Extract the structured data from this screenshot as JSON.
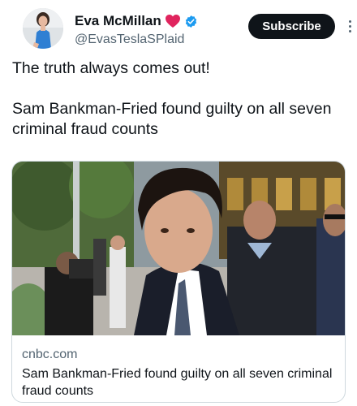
{
  "author": {
    "display_name": "Eva McMillan",
    "handle": "@EvasTeslaSPlaid",
    "avatar_icon": "profile-photo",
    "badge_icons": [
      "red-heart-icon",
      "verified-badge-icon"
    ]
  },
  "actions": {
    "subscribe_label": "Subscribe",
    "more_icon": "vertical-ellipsis-icon"
  },
  "tweet": {
    "line1": "The truth always comes out!",
    "line2": "Sam Bankman-Fried found guilty on all seven criminal fraud counts"
  },
  "card": {
    "domain": "cnbc.com",
    "title": "Sam Bankman-Fried found guilty on all seven criminal fraud counts"
  },
  "colors": {
    "text": "#0f1419",
    "secondary": "#536471",
    "verified": "#1d9bf0",
    "heart": "#e0245e",
    "button": "#0f1419",
    "border": "#cfd9de"
  }
}
